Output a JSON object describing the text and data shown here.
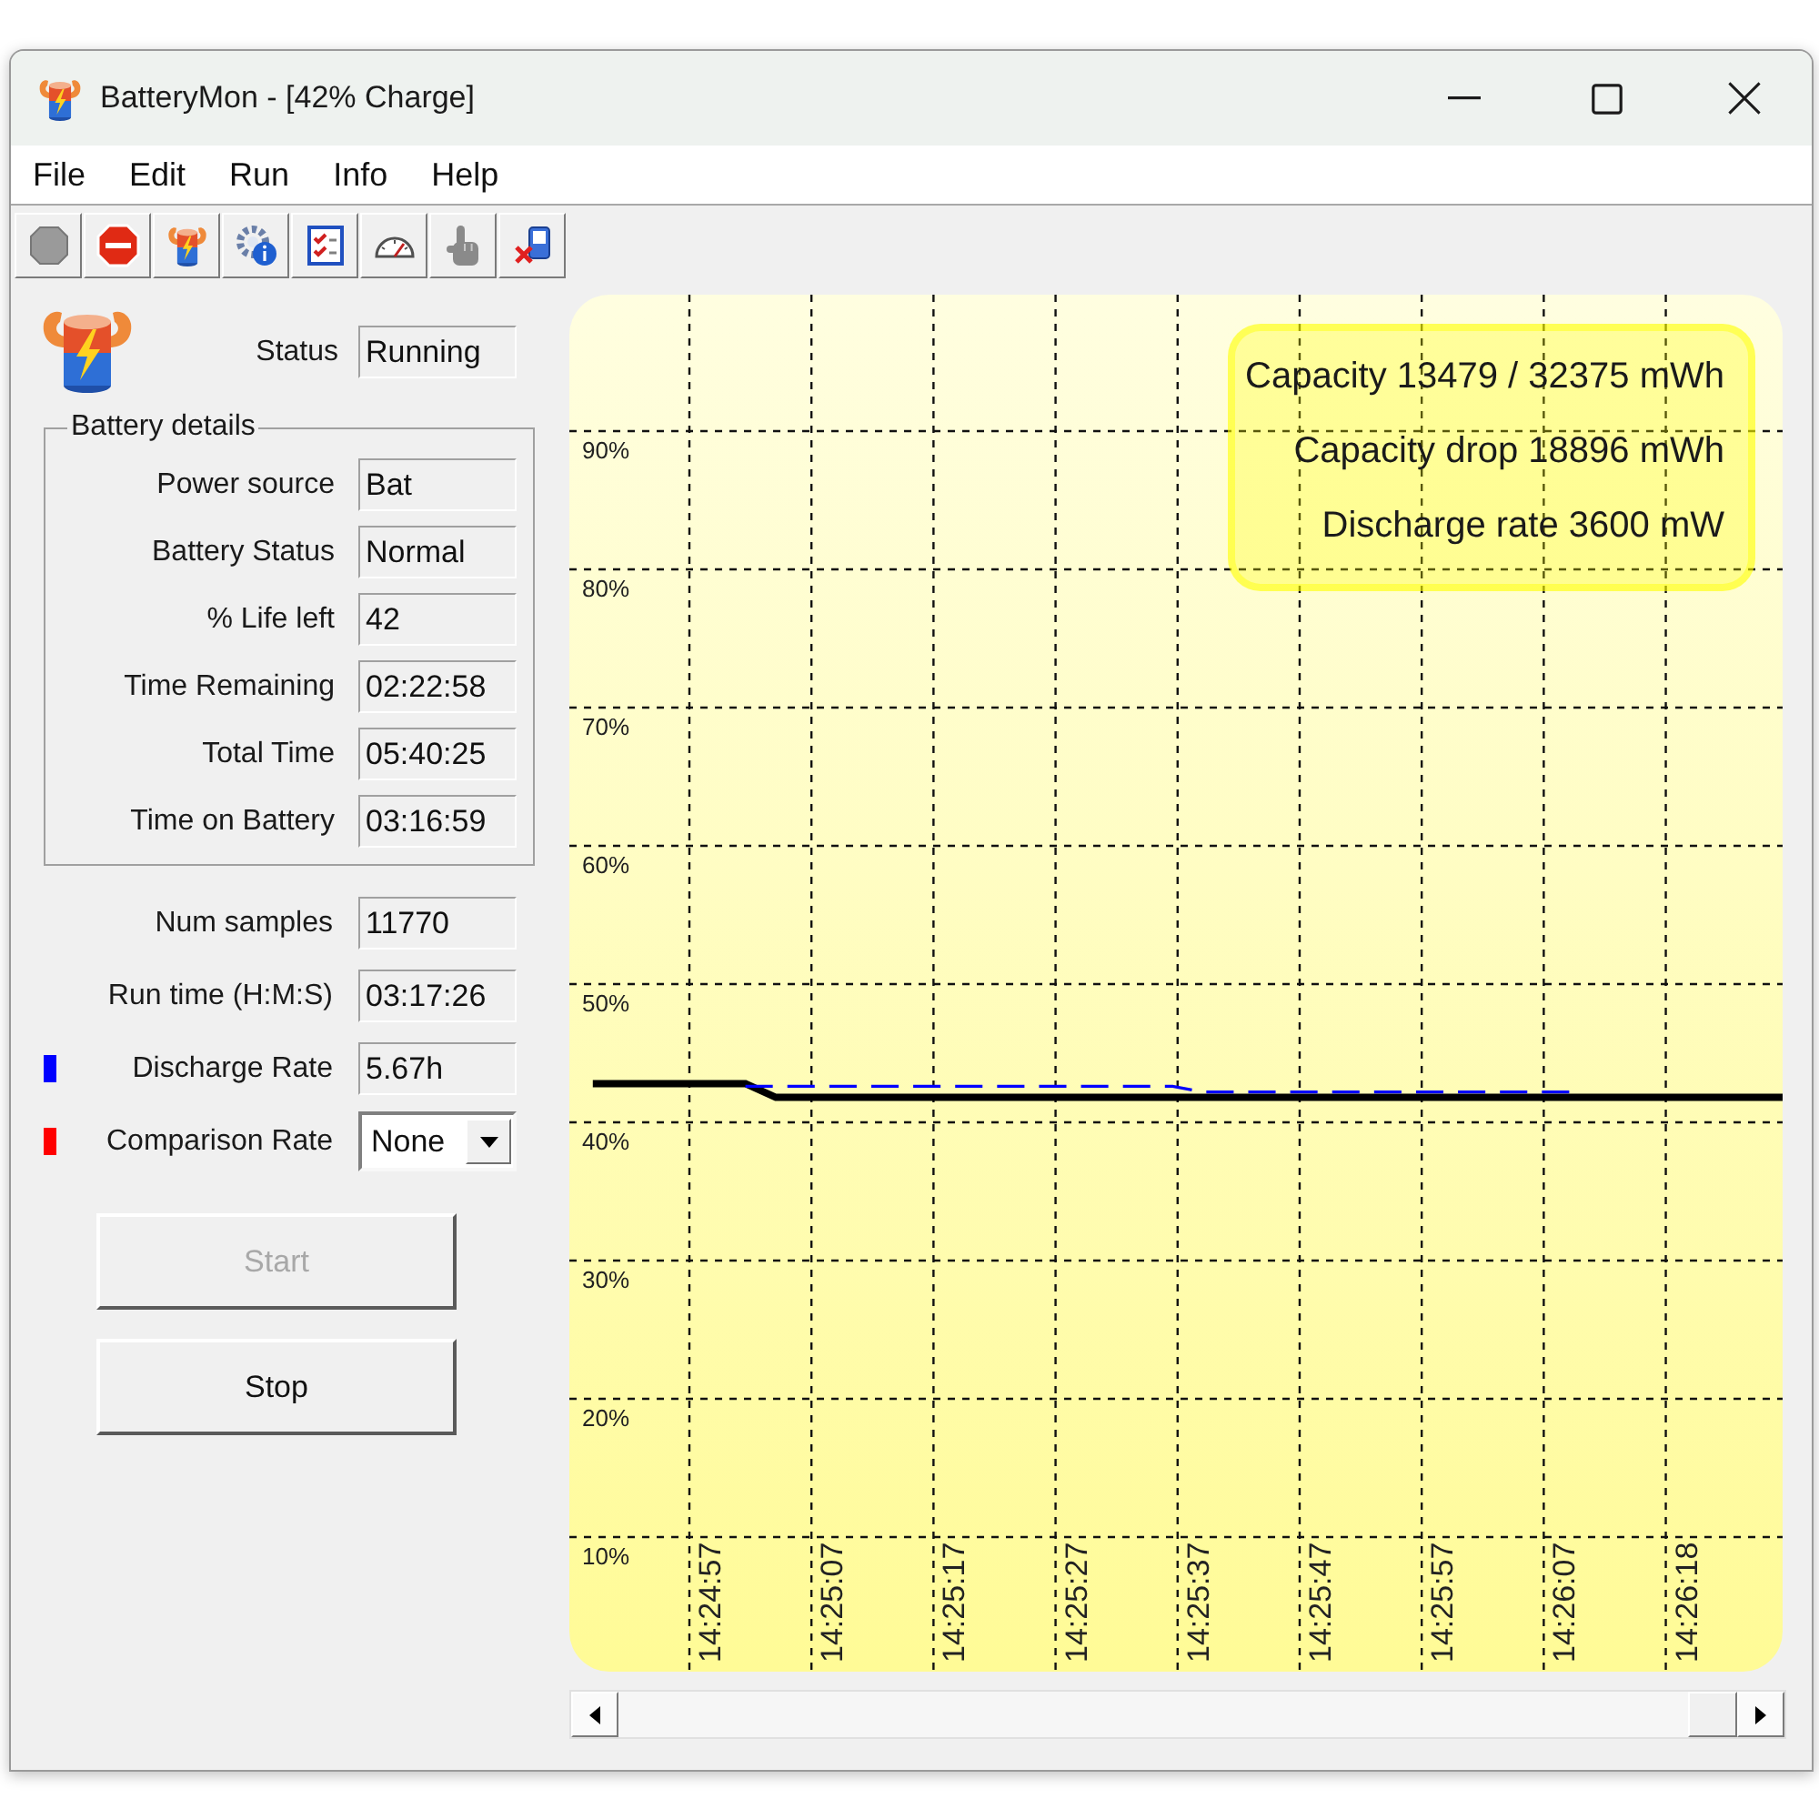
{
  "window": {
    "title": "BatteryMon - [42% Charge]"
  },
  "menu": [
    "File",
    "Edit",
    "Run",
    "Info",
    "Help"
  ],
  "status": {
    "label": "Status",
    "value": "Running"
  },
  "battery_details": {
    "title": "Battery details",
    "fields": [
      {
        "label": "Power source",
        "value": "Bat"
      },
      {
        "label": "Battery Status",
        "value": "Normal"
      },
      {
        "label": "% Life left",
        "value": "42"
      },
      {
        "label": "Time Remaining",
        "value": "02:22:58"
      },
      {
        "label": "Total Time",
        "value": "05:40:25"
      },
      {
        "label": "Time on Battery",
        "value": "03:16:59"
      }
    ]
  },
  "stats": [
    {
      "kind": "readout",
      "label": "Num samples",
      "value": "11770"
    },
    {
      "kind": "readout",
      "label": "Run time (H:M:S)",
      "value": "03:17:26"
    },
    {
      "kind": "readout",
      "label": "Discharge Rate",
      "value": "5.67h",
      "color": "#0000ff"
    },
    {
      "kind": "dropdown",
      "label": "Comparison Rate",
      "value": "None",
      "color": "#ff0000"
    }
  ],
  "buttons": [
    {
      "label": "Start",
      "disabled": true
    },
    {
      "label": "Stop",
      "disabled": false
    }
  ],
  "chart": {
    "info": [
      "Capacity 13479 / 32375 mWh",
      "Capacity drop 18896 mWh",
      "Discharge rate 3600 mW"
    ],
    "chart_data": {
      "type": "line",
      "grid": true,
      "categories": [
        null,
        null,
        null,
        null,
        "14:24:57",
        null,
        null,
        null,
        "14:25:07",
        null,
        null,
        null,
        "14:25:17",
        null,
        null,
        null,
        "14:25:27",
        null,
        null,
        null,
        "14:25:37",
        null,
        null,
        null,
        "14:25:47",
        null,
        null,
        null,
        "14:25:57",
        null,
        null,
        null,
        "14:26:07",
        null,
        null,
        null,
        "14:26:18",
        null,
        null,
        null
      ],
      "series": [
        {
          "color": "#000000",
          "line_style": "solid",
          "values": [
            42.8,
            42.8,
            42.8,
            42.8,
            42.8,
            42.8,
            41.8,
            41.8,
            41.8,
            41.8,
            41.8,
            41.8,
            41.8,
            41.8,
            41.8,
            41.8,
            41.8,
            41.8,
            41.8,
            41.8,
            41.8,
            41.8,
            41.8,
            41.8,
            41.8,
            41.8,
            41.8,
            41.8,
            41.8,
            41.8,
            41.8,
            41.8,
            41.8,
            41.8,
            41.8,
            41.8,
            41.8,
            41.8,
            41.8,
            41.8
          ]
        },
        {
          "color": "#0000ff",
          "line_style": "dashed",
          "values": [
            null,
            null,
            null,
            null,
            null,
            42.6,
            42.6,
            42.6,
            42.6,
            42.6,
            42.6,
            42.6,
            42.6,
            42.6,
            42.6,
            42.6,
            42.6,
            42.6,
            42.6,
            42.6,
            42.2,
            42.2,
            42.2,
            42.2,
            42.2,
            42.2,
            42.2,
            42.2,
            42.2,
            42.2,
            42.2,
            42.2,
            42.2,
            null,
            null,
            null,
            null,
            null,
            null,
            null
          ]
        }
      ],
      "ylim": [
        0,
        100
      ],
      "yticks": [
        {
          "value": 90,
          "label": "90%"
        },
        {
          "value": 80,
          "label": "80%"
        },
        {
          "value": 70,
          "label": "70%"
        },
        {
          "value": 60,
          "label": "60%"
        },
        {
          "value": 50,
          "label": "50%"
        },
        {
          "value": 40,
          "label": "40%"
        },
        {
          "value": 30,
          "label": "30%"
        },
        {
          "value": 20,
          "label": "20%"
        },
        {
          "value": 10,
          "label": "10%"
        }
      ]
    }
  }
}
